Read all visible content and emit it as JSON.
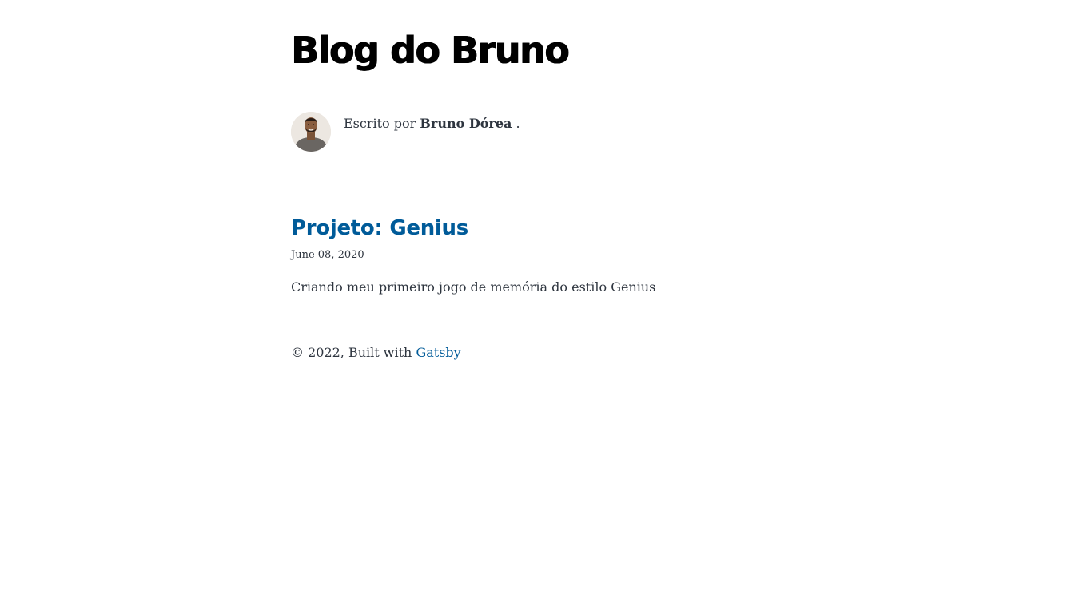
{
  "header": {
    "site_title": "Blog do Bruno"
  },
  "bio": {
    "avatar_icon": "author-avatar-photo",
    "prefix": "Escrito por",
    "author_name": "Bruno Dórea",
    "suffix": "."
  },
  "posts": [
    {
      "title": "Projeto: Genius",
      "date": "June 08, 2020",
      "description": "Criando meu primeiro jogo de memória do estilo Genius"
    }
  ],
  "footer": {
    "copyright_text": "© 2022, Built with",
    "link_label": "Gatsby"
  },
  "colors": {
    "accent": "#005b99",
    "text": "#2e353f",
    "title": "#000000",
    "background": "#ffffff"
  }
}
